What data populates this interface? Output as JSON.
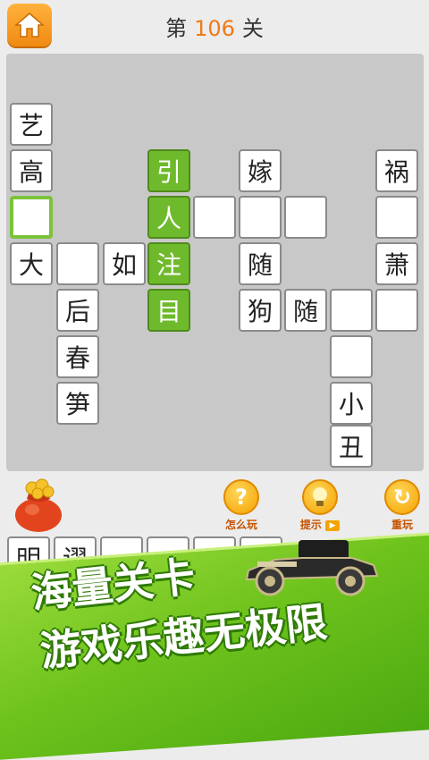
{
  "header": {
    "level_prefix": "第",
    "level_number": "106",
    "level_suffix": "关"
  },
  "board_cells": {
    "c1": "艺",
    "c2": "高",
    "c3": "",
    "c4": "大",
    "c5": "",
    "c6": "如",
    "c7": "后",
    "c8": "春",
    "c9": "笋",
    "g1": "引",
    "g2": "人",
    "g3": "注",
    "g4": "目",
    "c10": "",
    "c11": "",
    "c12": "",
    "c13": "嫁",
    "c14": "随",
    "c15": "狗",
    "c16": "随",
    "c17": "祸",
    "c18": "",
    "c19": "萧",
    "c20": "",
    "c21": "",
    "c22": "",
    "c23": "小",
    "c24": "丑"
  },
  "tools": {
    "how_to_play": "怎么玩",
    "hint": "提示",
    "replay": "重玩"
  },
  "tray": {
    "t1": "明",
    "t2": "谬",
    "t3": "",
    "t4": "",
    "t5": "",
    "t6": ""
  },
  "banner": {
    "line1": "海量关卡",
    "line2": "游戏乐趣无极限"
  }
}
